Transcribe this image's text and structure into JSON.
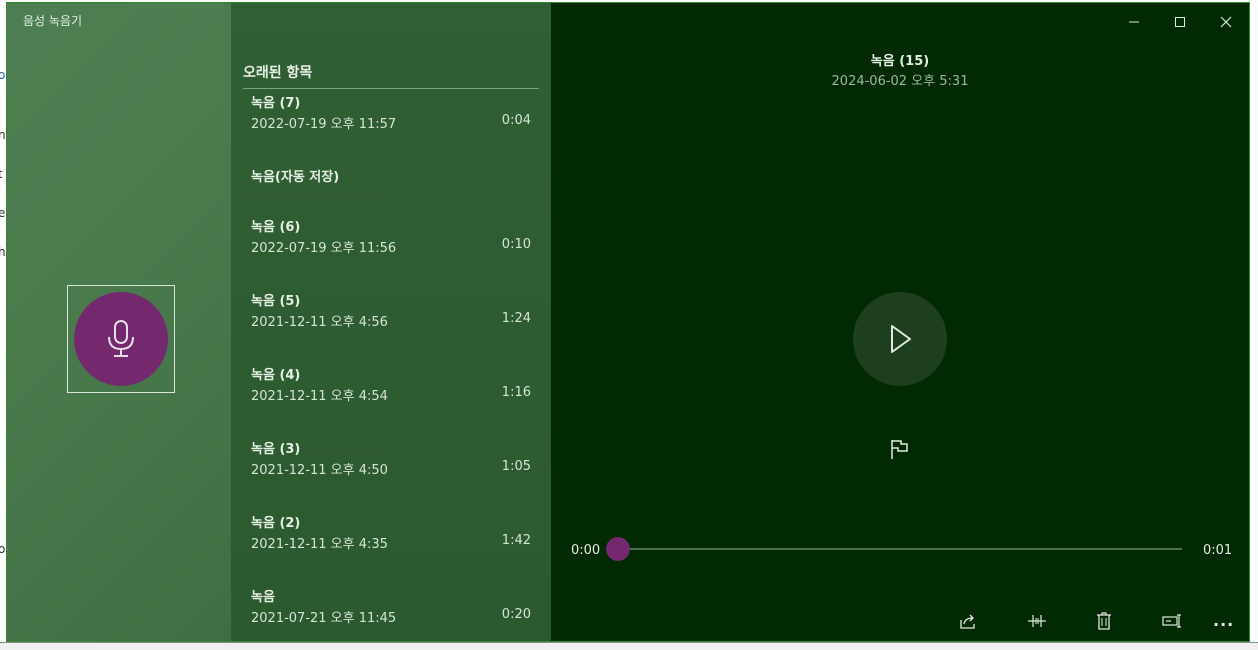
{
  "background_window": {
    "fragments": [
      "o",
      "n",
      "t",
      "e",
      "h",
      "o"
    ]
  },
  "app": {
    "title": "음성 녹음기",
    "record_button": {
      "icon": "microphone-icon",
      "color": "#74286e"
    }
  },
  "list": {
    "section_header": "오래된 항목",
    "items_top": [
      {
        "name": "녹음 (7)",
        "date": "2022-07-19 오후 11:57",
        "duration": "0:04"
      }
    ],
    "autosave_label": "녹음(자동 저장)",
    "items": [
      {
        "name": "녹음 (6)",
        "date": "2022-07-19 오후 11:56",
        "duration": "0:10"
      },
      {
        "name": "녹음 (5)",
        "date": "2021-12-11 오후 4:56",
        "duration": "1:24"
      },
      {
        "name": "녹음 (4)",
        "date": "2021-12-11 오후 4:54",
        "duration": "1:16"
      },
      {
        "name": "녹음 (3)",
        "date": "2021-12-11 오후 4:50",
        "duration": "1:05"
      },
      {
        "name": "녹음 (2)",
        "date": "2021-12-11 오후 4:35",
        "duration": "1:42"
      },
      {
        "name": "녹음",
        "date": "2021-07-21 오후 11:45",
        "duration": "0:20"
      }
    ]
  },
  "player": {
    "title": "녹음 (15)",
    "date": "2024-06-02 오후 5:31",
    "current_time": "0:00",
    "total_time": "0:01",
    "progress": 0,
    "accent": "#74286e"
  },
  "toolbar": {
    "icons": [
      "share-icon",
      "trim-icon",
      "delete-icon",
      "rename-icon",
      "more-icon"
    ],
    "more_label": "..."
  },
  "window_controls": [
    "minimize-icon",
    "maximize-icon",
    "close-icon"
  ]
}
